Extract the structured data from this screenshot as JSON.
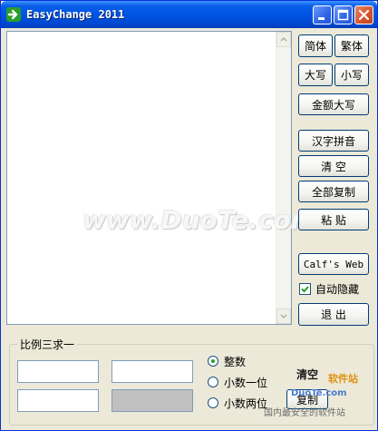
{
  "window": {
    "title": "EasyChange 2011"
  },
  "buttons": {
    "simplified": "简体",
    "traditional": "繁体",
    "uppercase": "大写",
    "lowercase": "小写",
    "amount_upper": "金额大写",
    "pinyin": "汉字拼音",
    "clear": "清    空",
    "copy_all": "全部复制",
    "paste": "粘    贴",
    "web": "Calf's Web",
    "exit": "退  出",
    "group_clear": "清空",
    "group_copy": "复制"
  },
  "auto_hide": {
    "label": "自动隐藏",
    "checked": true
  },
  "ratio_group": {
    "title": "比例三求一",
    "options": [
      "整数",
      "小数一位",
      "小数两位"
    ],
    "selected": "整数"
  },
  "watermarks": {
    "main": "www.DuoTe.com",
    "site_label": "软件站",
    "site_url": "DuoTe.com",
    "slogan": "国内最安全的软件站"
  }
}
